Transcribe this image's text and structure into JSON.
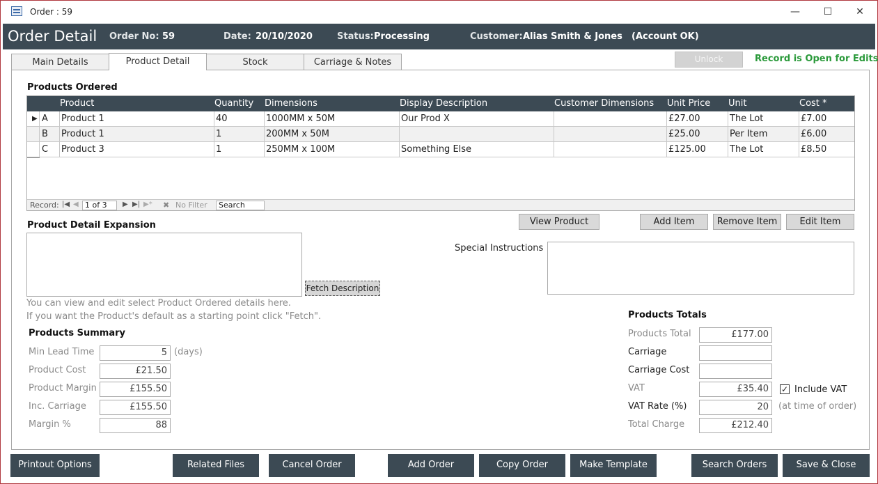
{
  "window": {
    "title": "Order : 59"
  },
  "header": {
    "title": "Order Detail",
    "order_no_label": "Order No:",
    "order_no": "59",
    "date_label": "Date:",
    "date": "20/10/2020",
    "status_label": "Status:",
    "status": "Processing",
    "customer_label": "Customer:",
    "customer": "Alias Smith & Jones",
    "account": "(Account OK)"
  },
  "tabs": [
    {
      "label": "Main Details"
    },
    {
      "label": "Product Detail"
    },
    {
      "label": "Stock"
    },
    {
      "label": "Carriage & Notes"
    }
  ],
  "unlock_label": "Unlock",
  "record_status": "Record is Open for Edits",
  "products_ordered": {
    "title": "Products Ordered",
    "columns": [
      "Product",
      "Quantity",
      "Dimensions",
      "Display Description",
      "Customer Dimensions",
      "Unit Price",
      "Unit",
      "Cost *"
    ],
    "rows": [
      {
        "id": "A",
        "product": "Product 1",
        "quantity": "40",
        "dimensions": "1000MM  x  50M",
        "display_description": "Our Prod X",
        "customer_dimensions": "",
        "unit_price": "£27.00",
        "unit": "The Lot",
        "cost": "£7.00"
      },
      {
        "id": "B",
        "product": "Product 1",
        "quantity": "1",
        "dimensions": "200MM  x  50M",
        "display_description": "",
        "customer_dimensions": "",
        "unit_price": "£25.00",
        "unit": "Per Item",
        "cost": "£6.00"
      },
      {
        "id": "C",
        "product": "Product 3",
        "quantity": "1",
        "dimensions": "250MM  x  100M",
        "display_description": "Something Else",
        "customer_dimensions": "",
        "unit_price": "£125.00",
        "unit": "The Lot",
        "cost": "£8.50"
      }
    ],
    "navigator": {
      "record_label": "Record:",
      "position": "1 of 3",
      "filter": "No Filter",
      "search": "Search"
    }
  },
  "buttons": {
    "view_product": "View Product",
    "add_item": "Add Item",
    "remove_item": "Remove Item",
    "edit_item": "Edit Item",
    "fetch_description": "Fetch Description"
  },
  "expansion": {
    "title": "Product Detail Expansion",
    "help_line_1": "You can view and edit select Product Ordered details here.",
    "help_line_2": "If you want the Product's default as a starting point click \"Fetch\"."
  },
  "special_instructions_label": "Special Instructions",
  "summary": {
    "title": "Products Summary",
    "min_lead_time_label": "Min Lead Time",
    "min_lead_time": "5",
    "days_label": "(days)",
    "product_cost_label": "Product Cost",
    "product_cost": "£21.50",
    "product_margin_label": "Product Margin",
    "product_margin": "£155.50",
    "inc_carriage_label": "Inc. Carriage",
    "inc_carriage": "£155.50",
    "margin_pct_label": "Margin %",
    "margin_pct": "88"
  },
  "totals": {
    "title": "Products Totals",
    "products_total_label": "Products Total",
    "products_total": "£177.00",
    "carriage_label": "Carriage",
    "carriage": "",
    "carriage_cost_label": "Carriage Cost",
    "carriage_cost": "",
    "vat_label": "VAT",
    "vat": "£35.40",
    "include_vat_label": "Include VAT",
    "vat_rate_label": "VAT Rate (%)",
    "vat_rate": "20",
    "vat_note": "(at time of order)",
    "total_charge_label": "Total Charge",
    "total_charge": "£212.40"
  },
  "footer": {
    "printout": "Printout Options",
    "related_files": "Related Files",
    "cancel_order": "Cancel Order",
    "add_order": "Add Order",
    "copy_order": "Copy Order",
    "make_template": "Make Template",
    "search_orders": "Search Orders",
    "save_close": "Save & Close"
  },
  "colors": {
    "header": "#3c4a54",
    "status_green": "#2b9a3b"
  }
}
